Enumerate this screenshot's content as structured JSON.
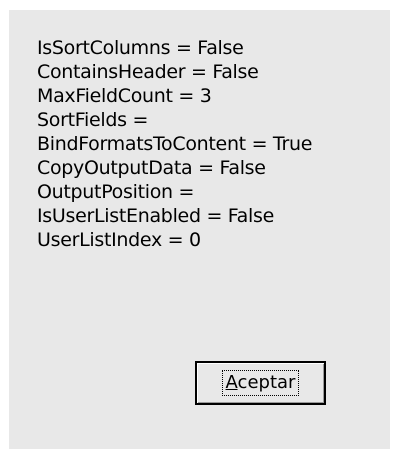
{
  "dialog": {
    "lines": [
      "IsSortColumns = False",
      "ContainsHeader = False",
      "MaxFieldCount = 3",
      "SortFields =",
      "BindFormatsToContent = True",
      "CopyOutputData = False",
      "OutputPosition =",
      "IsUserListEnabled = False",
      "UserListIndex = 0"
    ],
    "ok_button": {
      "mnemonic": "A",
      "rest": "ceptar"
    }
  }
}
